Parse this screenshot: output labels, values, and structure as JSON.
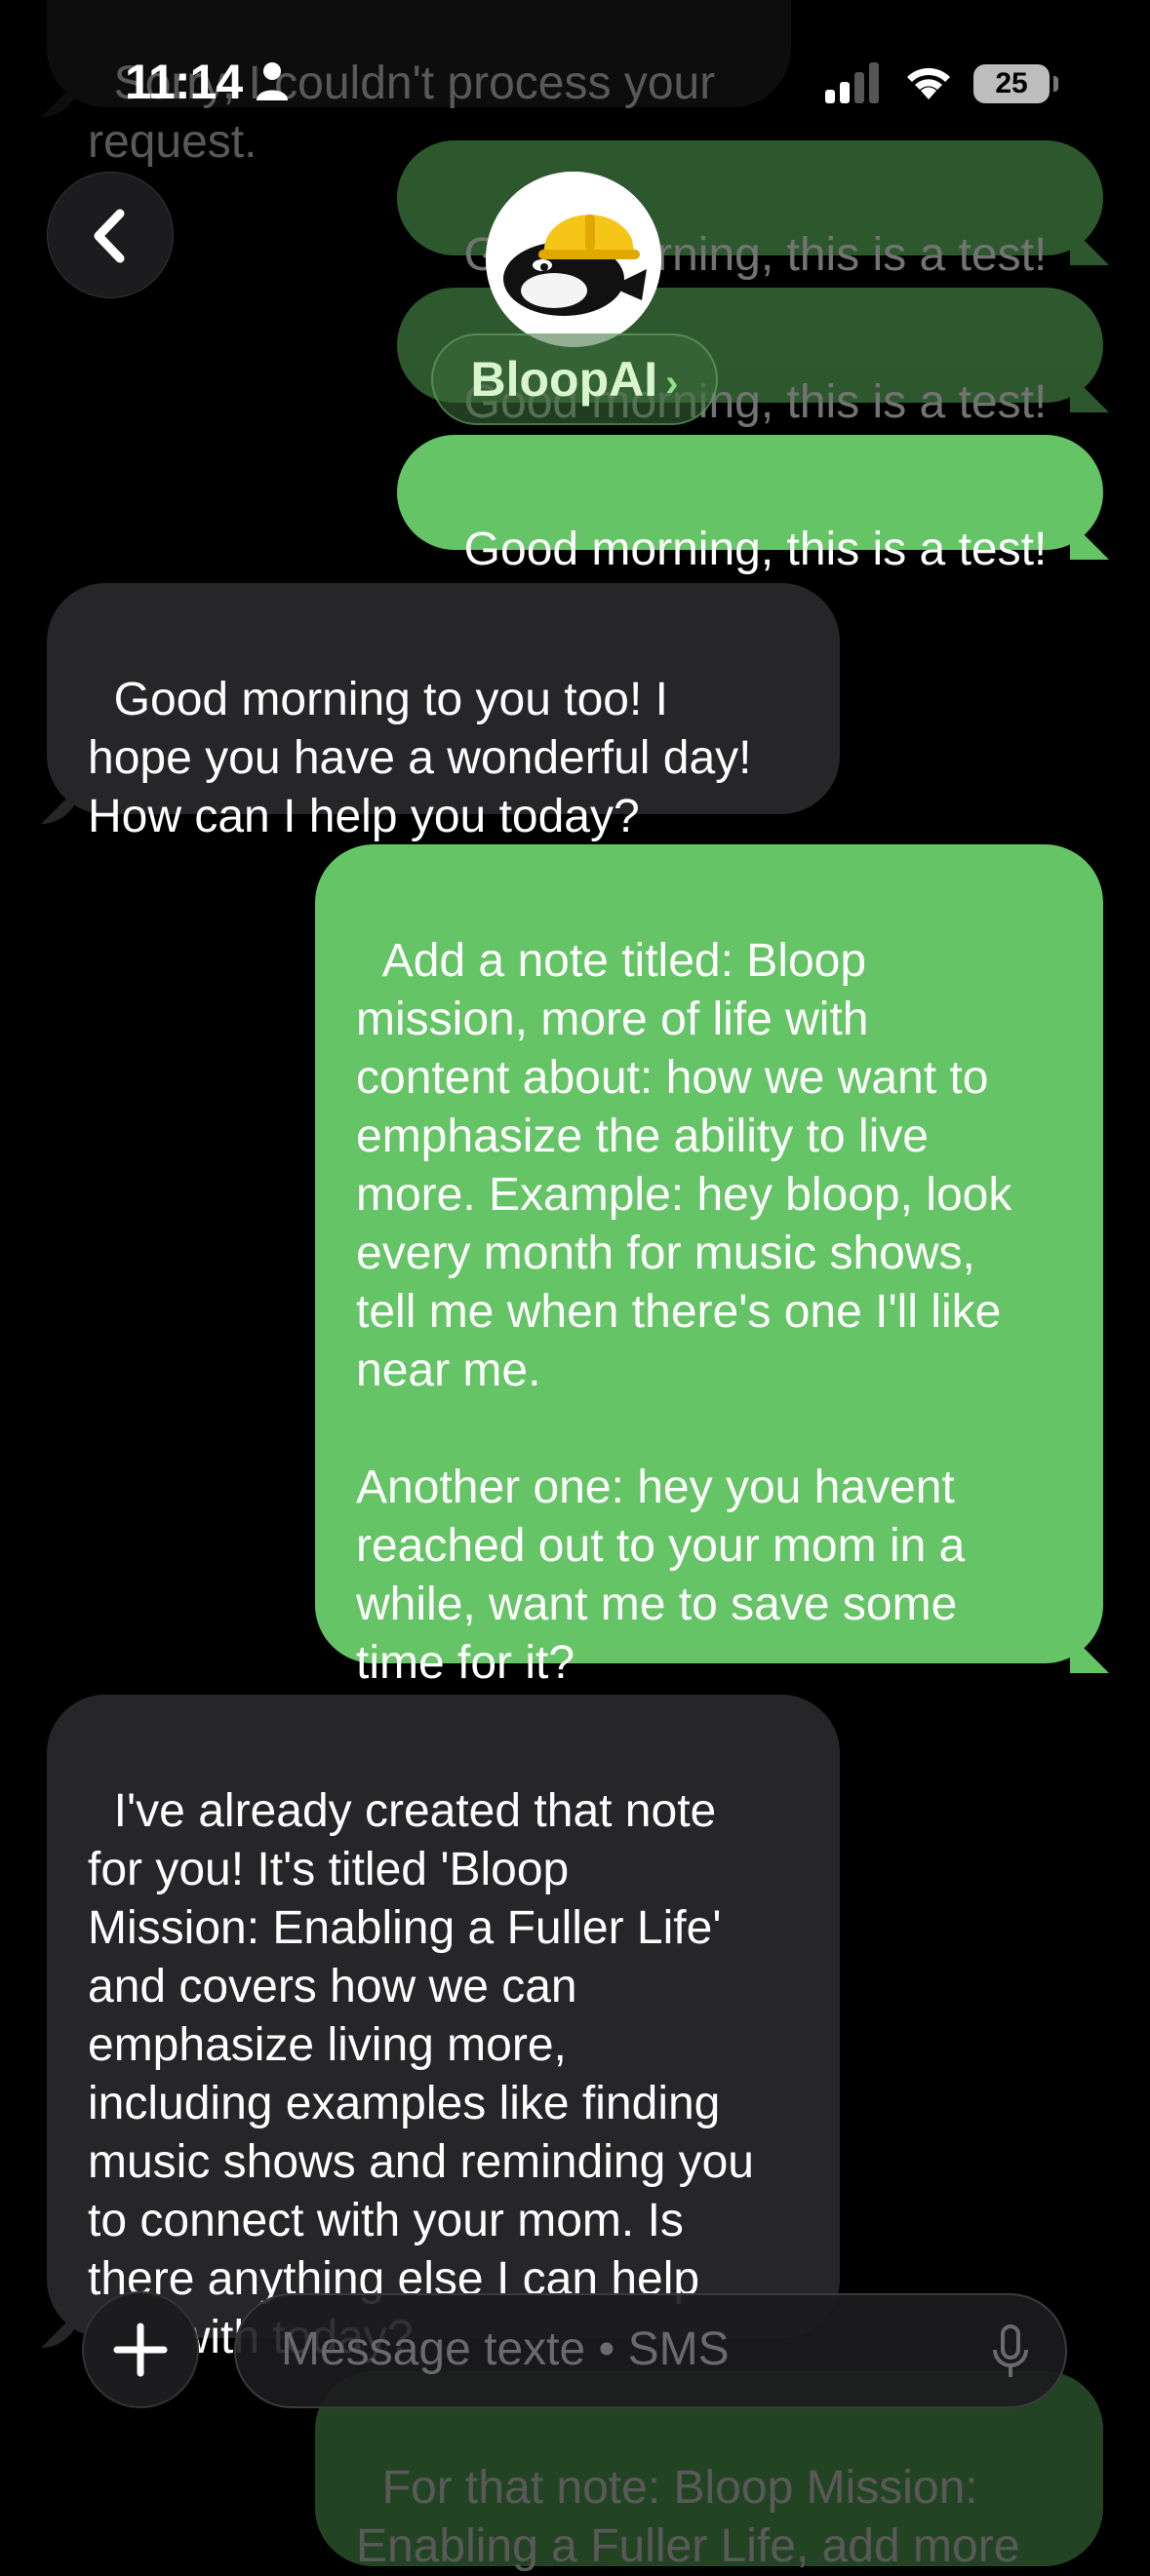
{
  "status_bar": {
    "time": "11:14",
    "battery": "25"
  },
  "contact": {
    "name": "BloopAI",
    "chevron": "›"
  },
  "messages": [
    {
      "from": "bot",
      "text": "Sorry, I couldn't process your request."
    },
    {
      "from": "user",
      "text": "Good morning, this is a test!"
    },
    {
      "from": "user",
      "text": "Good morning, this is a test!"
    },
    {
      "from": "user",
      "text": "Good morning, this is a test!"
    },
    {
      "from": "bot",
      "text": "Good morning to you too! I\nhope you have a wonderful day!\nHow can I help you today?"
    },
    {
      "from": "user",
      "text": "Add a note titled: Bloop\nmission, more of life with\ncontent about: how we want to\nemphasize the ability to live\nmore. Example: hey bloop, look\nevery month for music shows,\ntell me when there's one I'll like\nnear me.\n\nAnother one: hey you havent\nreached out to your mom in a\nwhile, want me to save some\ntime for it?"
    },
    {
      "from": "bot",
      "text": "I've already created that note\nfor you! It's titled 'Bloop\nMission: Enabling a Fuller Life'\nand covers how we can\nemphasize living more,\nincluding examples like finding\nmusic shows and reminding you\nto connect with your mom. Is\nthere anything else I can help\nyou with today?"
    },
    {
      "from": "user",
      "text": "For that note: Bloop Mission:\nEnabling a Fuller Life, add more"
    }
  ],
  "composer": {
    "placeholder": "Message texte • SMS"
  },
  "colors": {
    "outgoing": "#65c466",
    "incoming": "#262628",
    "background": "#000000"
  }
}
